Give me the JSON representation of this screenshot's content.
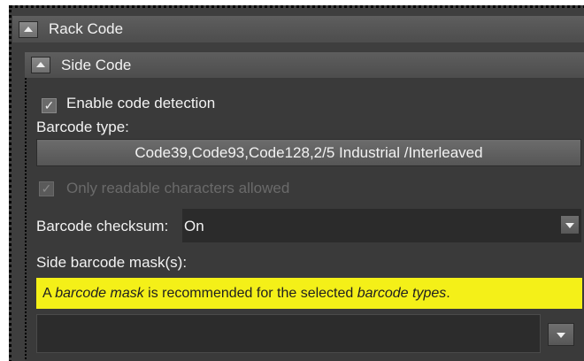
{
  "rack_code": {
    "title": "Rack Code",
    "collapse_icon": "chevron-up-icon"
  },
  "side_code": {
    "title": "Side Code",
    "collapse_icon": "chevron-up-icon",
    "enable_detection": {
      "label": "Enable code detection",
      "checked": true
    },
    "barcode_type": {
      "label": "Barcode type:",
      "value": "Code39,Code93,Code128,2/5 Industrial /Interleaved"
    },
    "readable_only": {
      "label": "Only readable characters allowed",
      "checked": true,
      "disabled": true
    },
    "checksum": {
      "label": "Barcode checksum:",
      "value": "On",
      "dropdown_icon": "chevron-down-icon"
    },
    "mask": {
      "label": "Side barcode mask(s):",
      "warning_parts": [
        "A ",
        "barcode mask",
        " is recommended for the selected ",
        "barcode types",
        "."
      ],
      "value": "",
      "dropdown_icon": "chevron-down-icon"
    }
  },
  "colors": {
    "panel": "#3e3e3e",
    "header": "#555555",
    "warning": "#f4f018",
    "text": "#f2f2f2"
  }
}
